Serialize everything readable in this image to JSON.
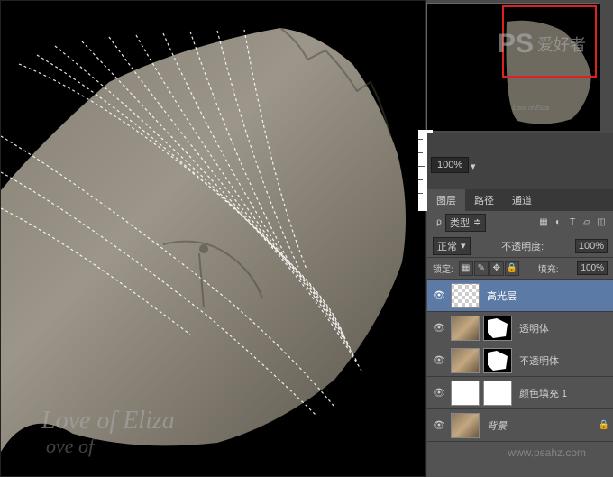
{
  "canvas": {
    "watermark_main": "Love of Eliza",
    "watermark_sub": "ove of"
  },
  "zoom": {
    "value": "100%"
  },
  "tabs": {
    "layers": "图层",
    "paths": "路径",
    "channels": "通道"
  },
  "filter_row": {
    "kind_icon": "ρ",
    "kind_label": "类型",
    "dropdown_icon": "≑"
  },
  "blend_row": {
    "mode": "正常",
    "opacity_label": "不透明度:",
    "opacity_value": "100%"
  },
  "lock_row": {
    "label": "锁定:",
    "fill_label": "填充:",
    "fill_value": "100%"
  },
  "layers": [
    {
      "name": "高光层",
      "selected": true,
      "thumb": "trans",
      "mask": null
    },
    {
      "name": "透明体",
      "selected": false,
      "thumb": "photo",
      "mask": "shape"
    },
    {
      "name": "不透明体",
      "selected": false,
      "thumb": "photo",
      "mask": "shape2"
    },
    {
      "name": "颜色填充 1",
      "selected": false,
      "thumb": "white",
      "mask": "white"
    },
    {
      "name": "背景",
      "selected": false,
      "thumb": "photo",
      "mask": null,
      "locked": true,
      "italic": true
    }
  ],
  "watermark": {
    "logo": "PS",
    "text": "爱好者",
    "url": "www.psahz.com"
  }
}
